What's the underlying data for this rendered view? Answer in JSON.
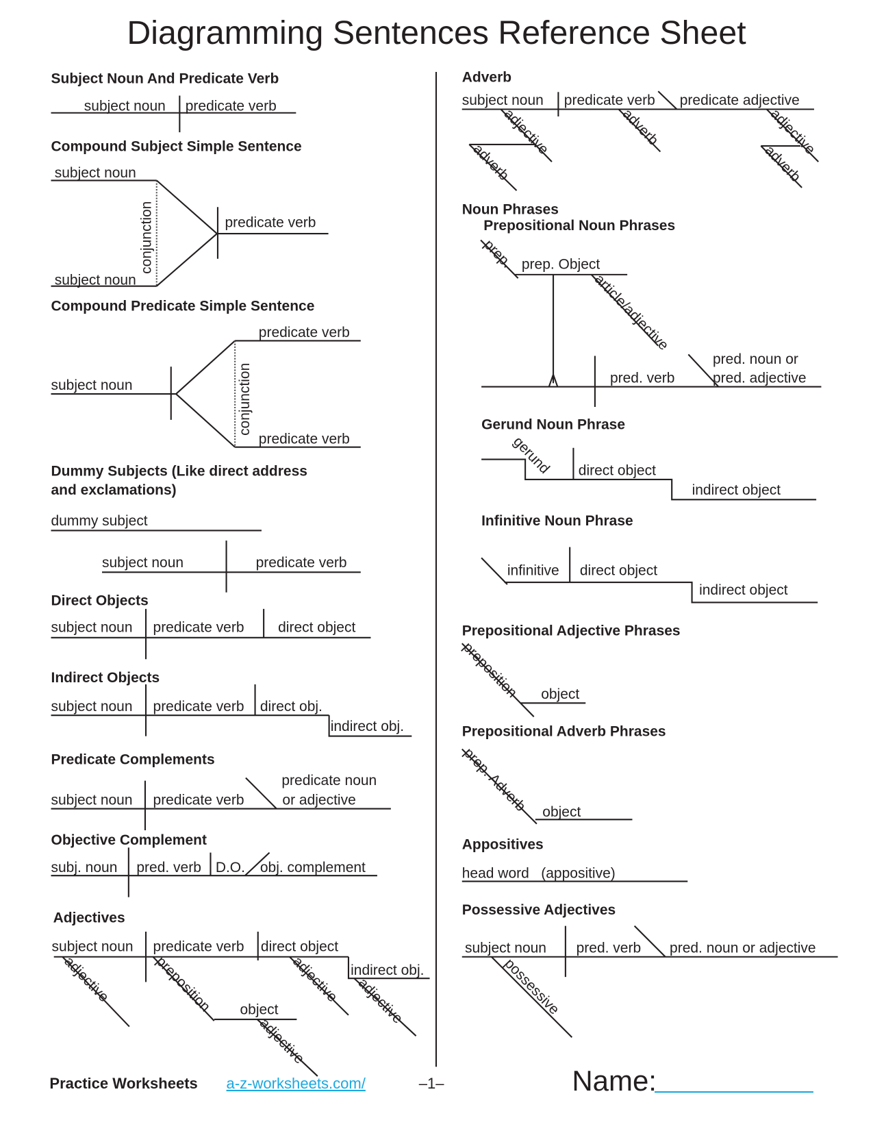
{
  "title": "Diagramming Sentences Reference Sheet",
  "left": {
    "s1": {
      "heading": "Subject Noun And Predicate Verb",
      "subject": "subject noun",
      "verb": "predicate verb"
    },
    "s2": {
      "heading": "Compound Subject Simple Sentence",
      "subject_top": "subject noun",
      "subject_bottom": "subject noun",
      "conjunction": "conjunction",
      "verb": "predicate verb"
    },
    "s3": {
      "heading": "Compound Predicate Simple Sentence",
      "subject": "subject noun",
      "verb_top": "predicate verb",
      "verb_bottom": "predicate verb",
      "conjunction": "conjunction"
    },
    "s4": {
      "heading_line1": "Dummy Subjects (Like direct address",
      "heading_line2": "and exclamations)",
      "dummy": "dummy subject",
      "subject": "subject noun",
      "verb": "predicate verb"
    },
    "s5": {
      "heading": "Direct Objects",
      "subject": "subject noun",
      "verb": "predicate verb",
      "object": "direct object"
    },
    "s6": {
      "heading": "Indirect Objects",
      "subject": "subject noun",
      "verb": "predicate verb",
      "direct": "direct obj.",
      "indirect": "indirect obj."
    },
    "s7": {
      "heading": "Predicate Complements",
      "subject": "subject noun",
      "verb": "predicate verb",
      "complement_line1": "predicate noun",
      "complement_line2": "or adjective"
    },
    "s8": {
      "heading": "Objective Complement",
      "subject": "subj. noun",
      "verb": "pred. verb",
      "direct": "D.O.",
      "complement": "obj. complement"
    },
    "s9": {
      "heading": "Adjectives",
      "subject": "subject noun",
      "verb": "predicate verb",
      "direct": "direct object",
      "indirect": "indirect obj.",
      "adj1": "adjective",
      "preposition": "preposition",
      "object": "object",
      "adj2": "adjective",
      "adj3": "adjective",
      "adj4": "adjective"
    }
  },
  "right": {
    "r1": {
      "heading": "Adverb",
      "subject": "subject noun",
      "verb": "predicate verb",
      "pred_adj": "predicate adjective",
      "adjective1": "adjective",
      "adverb1": "adverb",
      "adverb2": "adverb",
      "adjective2": "adjective",
      "adverb3": "adverb"
    },
    "r2": {
      "heading": "Noun Phrases",
      "subheading": "Prepositional Noun Phrases",
      "prep": "prep.",
      "prep_object": "prep. Object",
      "article": "article/adjective",
      "pred_verb": "pred. verb",
      "pred_noun_line1": "pred. noun or",
      "pred_noun_line2": "pred. adjective"
    },
    "r3": {
      "heading": "Gerund Noun Phrase",
      "gerund": "gerund",
      "direct": "direct object",
      "indirect": "indirect object"
    },
    "r4": {
      "heading": "Infinitive Noun Phrase",
      "infinitive": "infinitive",
      "direct": "direct object",
      "indirect": "indirect object"
    },
    "r5": {
      "heading": "Prepositional Adjective Phrases",
      "preposition": "preposition",
      "object": "object"
    },
    "r6": {
      "heading": "Prepositional Adverb Phrases",
      "preposition": "prep. Adverb",
      "object": "object"
    },
    "r7": {
      "heading": "Appositives",
      "text": "head word   (appositive)"
    },
    "r8": {
      "heading": "Possessive Adjectives",
      "subject": "subject noun",
      "verb": "pred. verb",
      "complement": "pred. noun or adjective",
      "possessive": "possessive"
    }
  },
  "footer": {
    "brand": "Practice Worksheets",
    "link": "a-z-worksheets.com/",
    "page": "–1–",
    "name_label": "Name:",
    "accent": "#1ba8e0"
  }
}
